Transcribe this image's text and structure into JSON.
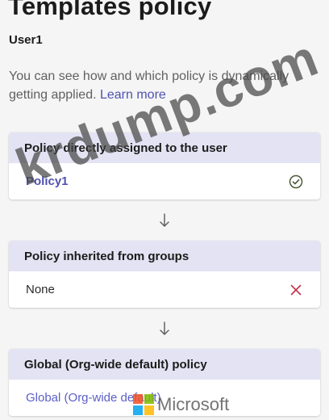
{
  "page": {
    "title": "Templates policy",
    "user": "User1",
    "description": "You can see how and which policy is dynamically getting applied.",
    "learn_more": "Learn more"
  },
  "cards": [
    {
      "header": "Policy directly assigned to the user",
      "value": "Policy1",
      "status_icon": "check-circle-icon"
    },
    {
      "header": "Policy inherited from groups",
      "value": "None",
      "status_icon": "close-icon"
    },
    {
      "header": "Global (Org-wide default) policy",
      "value": "Global (Org-wide default)"
    }
  ],
  "arrow_icon": "arrow-down-icon",
  "watermark": {
    "text": "krdump.com",
    "brand": "Microsoft"
  },
  "colors": {
    "accent": "#4f52b2",
    "card_header_bg": "#e3e3f3",
    "check": "#4a5a38",
    "close": "#c4314b"
  }
}
